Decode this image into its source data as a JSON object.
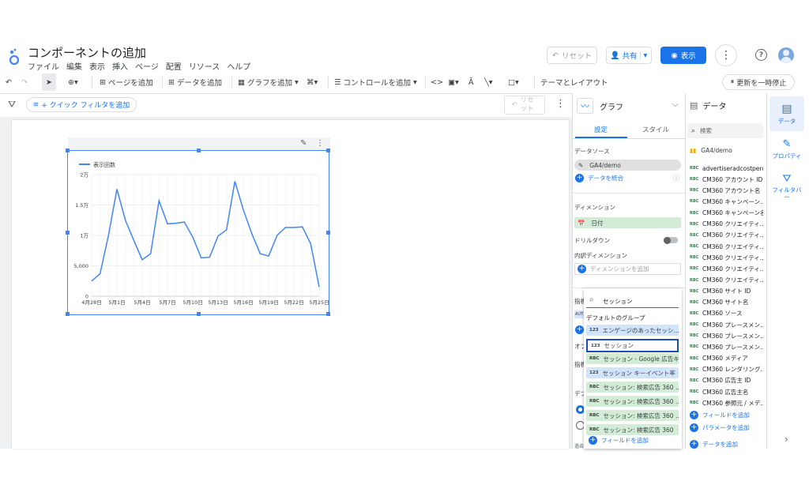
{
  "header": {
    "title": "コンポーネントの追加",
    "menu": [
      "ファイル",
      "編集",
      "表示",
      "挿入",
      "ページ",
      "配置",
      "リソース",
      "ヘルプ"
    ],
    "reset_label": "リセット",
    "share_label": "共有",
    "view_label": "表示"
  },
  "toolbar": {
    "add_page": "ページを追加",
    "add_data": "データを追加",
    "add_chart": "グラフを追加",
    "add_control": "コントロールを追加",
    "theme_layout": "テーマとレイアウト",
    "pause_updates": "更新を一時停止"
  },
  "filterbar": {
    "quick_filter": "+ クイック フィルタを追加",
    "reset": "リセット"
  },
  "chart": {
    "legend": "表示回数",
    "y_ticks": [
      "2万",
      "1.5万",
      "1万",
      "5,000",
      "0"
    ],
    "x_ticks": [
      "4月28日",
      "5月1日",
      "5月4日",
      "5月7日",
      "5月10日",
      "5月13日",
      "5月16日",
      "5月19日",
      "5月22日",
      "5月25日"
    ]
  },
  "chart_data": {
    "type": "line",
    "title": "",
    "xlabel": "",
    "ylabel": "",
    "ylim": [
      0,
      20000
    ],
    "series": [
      {
        "name": "表示回数",
        "values": [
          2500,
          3700,
          10000,
          17600,
          12500,
          9200,
          6000,
          7000,
          15700,
          11900,
          12000,
          12200,
          9700,
          6300,
          6400,
          9900,
          10900,
          18900,
          14200,
          10300,
          7000,
          6600,
          10000,
          11300,
          11300,
          11400,
          8600,
          1500
        ]
      }
    ],
    "x_ticks": [
      "4月28日",
      "5月1日",
      "5月4日",
      "5月7日",
      "5月10日",
      "5月13日",
      "5月16日",
      "5月19日",
      "5月22日",
      "5月25日"
    ],
    "grid": true,
    "legend": "top-left",
    "color": "#4285f4"
  },
  "graph_panel": {
    "title": "グラフ",
    "tab_setup": "設定",
    "tab_style": "スタイル",
    "data_source_label": "データソース",
    "data_source": "GA4/demo",
    "blend_data": "データを統合",
    "dimension_label": "ディメンション",
    "dimension_value": "日付",
    "drilldown_label": "ドリルダウン",
    "breakdown_label": "内訳ディメンション",
    "add_dimension": "ディメンションを追加",
    "metric_label": "指標",
    "metric_tag": "AUT",
    "optional_label": "オフ",
    "sort_label": "指標",
    "default_label": "デフ",
    "bottom_label": "過去"
  },
  "dropdown": {
    "search_value": "セッション",
    "group_label": "デフォルトのグループ",
    "items": [
      {
        "tag": "123",
        "label": "エンゲージのあったセッシ…",
        "kind": "blue"
      },
      {
        "tag": "123",
        "label": "セッション",
        "kind": "selected"
      },
      {
        "tag": "RBC",
        "label": "セッション - Google 広告キ…",
        "kind": "green"
      },
      {
        "tag": "123",
        "label": "セッション キーイベント率",
        "kind": "blue"
      },
      {
        "tag": "RBC",
        "label": "セッション: 検索広告 360 …",
        "kind": "green"
      },
      {
        "tag": "RBC",
        "label": "セッション: 検索広告 360 …",
        "kind": "green"
      },
      {
        "tag": "RBC",
        "label": "セッション: 検索広告 360 …",
        "kind": "green"
      },
      {
        "tag": "RBC",
        "label": "セッション: 検索広告 360",
        "kind": "green"
      }
    ],
    "add_field": "フィールドを追加"
  },
  "data_panel": {
    "title": "データ",
    "search_placeholder": "検索",
    "source": "GA4/demo",
    "fields": [
      "advertiseradcostperc…",
      "CM360 アカウント ID",
      "CM360 アカウント名",
      "CM360 キャンペーン…",
      "CM360 キャンペーン名",
      "CM360 クリエイティ…",
      "CM360 クリエイティ…",
      "CM360 クリエイティ…",
      "CM360 クリエイティ…",
      "CM360 クリエイティ…",
      "CM360 クリエイティ…",
      "CM360 サイト ID",
      "CM360 サイト名",
      "CM360 ソース",
      "CM360 プレースメン…",
      "CM360 プレースメン…",
      "CM360 プレースメン…",
      "CM360 メディア",
      "CM360 レンダリング…",
      "CM360 広告主 ID",
      "CM360 広告主名",
      "CM360 参照元 / メデ…"
    ],
    "add_field": "フィールドを追加",
    "add_parameter": "パラメータを追加",
    "add_data": "データを追加"
  },
  "rail": {
    "data": "データ",
    "properties": "プロパティ",
    "filter": "フィルタバー"
  }
}
